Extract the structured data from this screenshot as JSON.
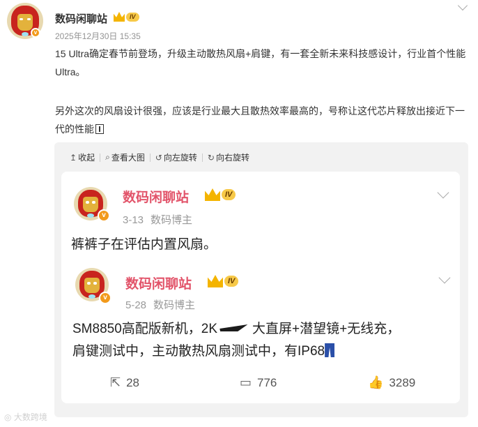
{
  "post": {
    "author": "数码闲聊站",
    "vip_level": "IV",
    "date": "2025年12月30日 15:35",
    "text_p1": "15 Ultra确定春节前登场，升级主动散热风扇+肩键，有一套全新未来科技感设计，行业首个性能Ultra。",
    "text_p2": "另外这次的风扇设计很强，应该是行业最大且散热效率最高的，号称让这代芯片释放出接近下一代的性能",
    "avatar_badge": "v"
  },
  "toolbar": {
    "collapse": "收起",
    "view_large": "查看大图",
    "rotate_left": "向左旋转",
    "rotate_right": "向右旋转"
  },
  "screenshot": {
    "post1": {
      "author": "数码闲聊站",
      "vip_level": "IV",
      "date": "3-13",
      "role": "数码博主",
      "text": "裤裤子在评估内置风扇。"
    },
    "post2": {
      "author": "数码闲聊站",
      "vip_level": "IV",
      "date": "5-28",
      "role": "数码博主",
      "line1_a": "SM8850高配版新机，2K",
      "line1_b": "大直屏+潜望镜+无线充，",
      "line2": "肩键测试中，主动散热风扇测试中，有IP68"
    },
    "actions": {
      "reposts": "28",
      "comments": "776",
      "likes": "3289"
    }
  },
  "watermark": "大数跨境",
  "colors": {
    "name_pink": "#e2546a",
    "vip_gold": "#f7c948",
    "badge_orange": "#f29a1b"
  }
}
